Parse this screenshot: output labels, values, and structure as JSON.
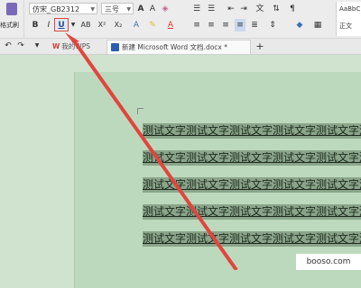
{
  "ribbon": {
    "format_painter_label": "格式刷",
    "font_name": "仿宋_GB2312",
    "font_size": "三号",
    "bold": "B",
    "italic": "I",
    "underline": "U",
    "abc": "AB",
    "superscript": "X²",
    "subscript": "X₂",
    "style_sample_top": "AaBbC",
    "style_sample_bottom": "正文"
  },
  "tabs": {
    "wps_tab": "我的WPS",
    "document_tab": "新建 Microsoft Word 文档.docx *",
    "add_tab": "+"
  },
  "document": {
    "lines": [
      "测试文字测试文字测试文字测试文字测试文字测试文字",
      "测试文字测试文字测试文字测试文字测试文字测试文字",
      "测试文字测试文字测试文字测试文字测试文字测试文字",
      "测试文字测试文字测试文字测试文字测试文字测试文字",
      "测试文字测试文字测试文字测试文字测试文字测试文字"
    ]
  },
  "watermark": "booso.com",
  "colors": {
    "annotation_arrow": "#e0463e",
    "document_background": "#cfe3cf",
    "selection_highlight": "#8aa58a"
  }
}
